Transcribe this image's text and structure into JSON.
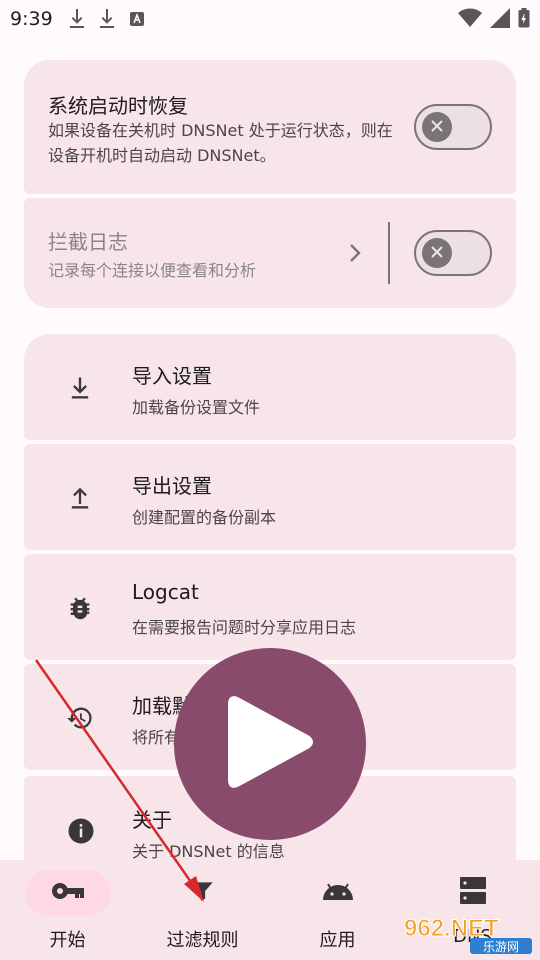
{
  "status_bar": {
    "time": "9:39"
  },
  "settings": {
    "restore_on_boot": {
      "title": "系统启动时恢复",
      "desc": "如果设备在关机时 DNSNet 处于运行状态，则在设备开机时自动启动 DNSNet。",
      "enabled": false
    },
    "block_log": {
      "title": "拦截日志",
      "desc": "记录每个连接以便查看和分析",
      "enabled": false
    }
  },
  "list": [
    {
      "title": "导入设置",
      "desc": "加载备份设置文件",
      "icon": "download-icon"
    },
    {
      "title": "导出设置",
      "desc": "创建配置的备份副本",
      "icon": "upload-icon"
    },
    {
      "title": "Logcat",
      "desc": "在需要报告问题时分享应用日志",
      "icon": "bug-icon"
    },
    {
      "title": "加载默",
      "desc": "将所有",
      "icon": "restore-icon"
    },
    {
      "title": "关于",
      "desc": "关于 DNSNet 的信息",
      "icon": "info-icon"
    }
  ],
  "fab": {
    "icon": "play-icon"
  },
  "bottom_nav": [
    {
      "label": "开始",
      "icon": "key-icon",
      "active": true
    },
    {
      "label": "过滤规则",
      "icon": "filter-icon",
      "active": false
    },
    {
      "label": "应用",
      "icon": "android-icon",
      "active": false
    },
    {
      "label": "DNS",
      "icon": "server-icon",
      "active": false
    }
  ],
  "watermark": {
    "text": "962.NET",
    "sub": "乐游网"
  },
  "colors": {
    "accent": "#884b6b",
    "surface": "#f8e5ea",
    "active_pill": "#ffd8e8"
  }
}
